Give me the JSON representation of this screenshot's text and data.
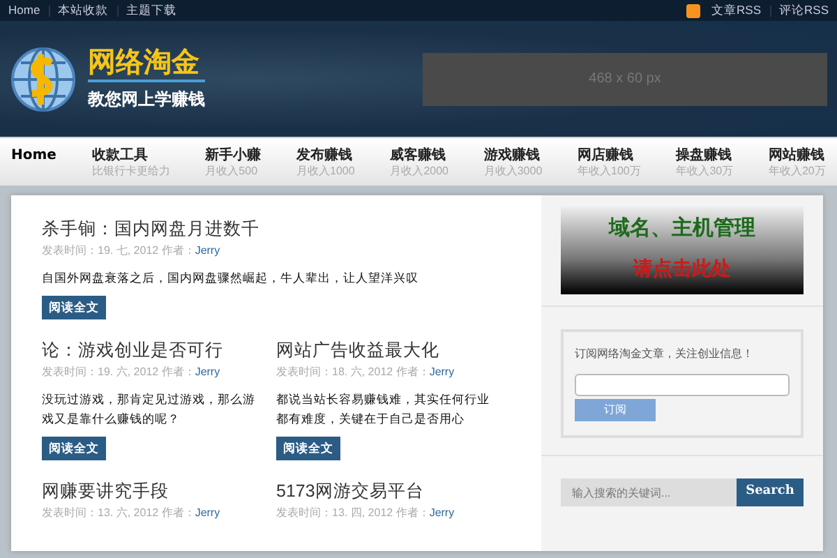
{
  "top_bar": {
    "links": [
      "Home",
      "本站收款",
      "主题下载"
    ],
    "rss_links": [
      "文章RSS",
      "评论RSS"
    ]
  },
  "header": {
    "logo_title": "网络淘金",
    "logo_slogan": "教您网上学赚钱",
    "ad_placeholder": "468 x 60 px"
  },
  "nav": [
    {
      "label": "Home",
      "selected": true
    },
    {
      "label": "收款工具",
      "sub": "比银行卡更给力",
      "selected": false
    },
    {
      "label": "新手小赚",
      "sub": "月收入500",
      "selected": false
    },
    {
      "label": "发布赚钱",
      "sub": "月收入1000",
      "selected": false
    },
    {
      "label": "威客赚钱",
      "sub": "月收入2000",
      "selected": false
    },
    {
      "label": "游戏赚钱",
      "sub": "月收入3000",
      "selected": false
    },
    {
      "label": "网店赚钱",
      "sub": "年收入100万",
      "selected": false
    },
    {
      "label": "操盘赚钱",
      "sub": "年收入30万",
      "selected": false
    },
    {
      "label": "网站赚钱",
      "sub": "年收入20万",
      "selected": false
    }
  ],
  "posts": [
    {
      "title": "杀手锏：国内网盘月进数千",
      "meta": "发表时间：19. 七, 2012 作者：",
      "author": "Jerry",
      "excerpt": "自国外网盘衰落之后，国内网盘骤然崛起，牛人辈出，让人望洋兴叹",
      "button": "阅读全文",
      "wide": true
    },
    {
      "title": "论：游戏创业是否可行",
      "meta": "发表时间：19. 六, 2012 作者：",
      "author": "Jerry",
      "excerpt": "没玩过游戏，那肯定见过游戏，那么游戏又是靠什么赚钱的呢？",
      "button": "阅读全文",
      "wide": false
    },
    {
      "title": "网站广告收益最大化",
      "meta": "发表时间：18. 六, 2012 作者：",
      "author": "Jerry",
      "excerpt": "都说当站长容易赚钱难，其实任何行业都有难度，关键在于自己是否用心",
      "button": "阅读全文",
      "wide": false
    },
    {
      "title": "网赚要讲究手段",
      "meta": "发表时间：13. 六, 2012 作者：",
      "author": "Jerry",
      "wide": false
    },
    {
      "title": "5173网游交易平台",
      "meta": "发表时间：13. 四, 2012 作者：",
      "author": "Jerry",
      "wide": false
    }
  ],
  "sidebar": {
    "banner_line1": "域名、主机管理",
    "banner_line2": "请点击此处",
    "subscribe_text": "订阅网络淘金文章，关注创业信息！",
    "subscribe_button": "订阅",
    "search_placeholder": "输入搜索的关键词...",
    "search_button": "Search"
  }
}
